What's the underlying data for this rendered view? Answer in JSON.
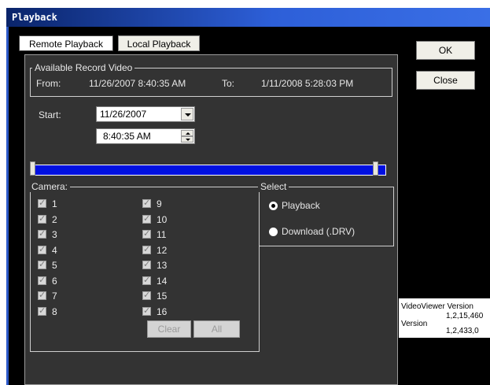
{
  "window": {
    "title": "Playback"
  },
  "tabs": [
    {
      "label": "Remote Playback",
      "active": true
    },
    {
      "label": "Local Playback",
      "active": false
    }
  ],
  "buttons": {
    "ok_label": "OK",
    "close_label": "Close",
    "clear_label": "Clear",
    "all_label": "All"
  },
  "record": {
    "group_label": "Available Record Video",
    "from_label": "From:",
    "from_value": "11/26/2007 8:40:35 AM",
    "to_label": "To:",
    "to_value": "1/11/2008 5:28:03 PM"
  },
  "start": {
    "label": "Start:",
    "date_value": "11/26/2007",
    "time_value": "8:40:35 AM"
  },
  "camera": {
    "group_label": "Camera:",
    "items": [
      "1",
      "2",
      "3",
      "4",
      "5",
      "6",
      "7",
      "8",
      "9",
      "10",
      "11",
      "12",
      "13",
      "14",
      "15",
      "16"
    ]
  },
  "select": {
    "group_label": "Select",
    "options": [
      {
        "label": "Playback",
        "selected": true
      },
      {
        "label": "Download (.DRV)",
        "selected": false
      }
    ]
  },
  "version": {
    "title": "VideoViewer Version",
    "value1": "1,2,15,460",
    "label": "Version",
    "value2": "1,2,433,0"
  },
  "colors": {
    "titlebar": "#0a246a",
    "timeline": "#0010e0",
    "panel": "#333333"
  }
}
